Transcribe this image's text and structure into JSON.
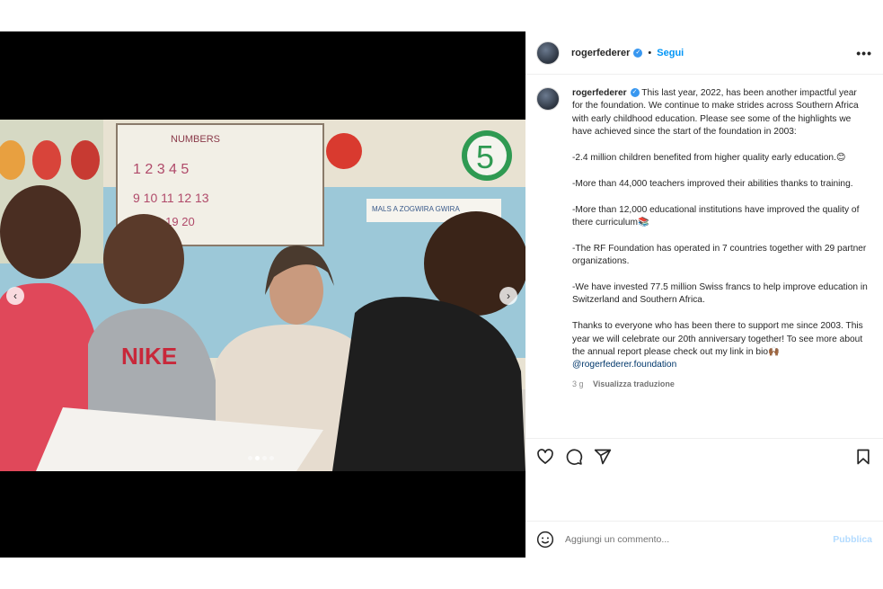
{
  "post": {
    "username": "rogerfederer",
    "follow_label": "Segui",
    "more_label": "•••",
    "separator": "•"
  },
  "media": {
    "prev_label": "‹",
    "next_label": "›",
    "carousel_count": 4,
    "carousel_active": 1
  },
  "caption": {
    "username": "rogerfederer",
    "paragraphs": [
      "This last year, 2022, has been another impactful year for the foundation. We continue to make strides across Southern Africa with early childhood education. Please see some of the highlights we have achieved since the start of the foundation in 2003:",
      "-2.4 million children benefited from higher quality early education.😊",
      "-More than 44,000 teachers improved their abilities thanks to training.",
      "-More than 12,000 educational institutions have improved the quality of there curriculum📚",
      "-The RF Foundation has operated in 7 countries together with 29 partner organizations.",
      "-We have invested 77.5 million Swiss francs to help improve education in Switzerland and Southern Africa."
    ],
    "closing_text": "Thanks to everyone who has been there to support me since 2003. This year we will celebrate our 20th anniversary together! To see more about the annual report please check out my link in bio🙌🏾",
    "mention": "@rogerfederer.foundation",
    "time_ago": "3 g",
    "translate_label": "Visualizza traduzione"
  },
  "actions": {
    "like": "heart-icon",
    "comment": "comment-icon",
    "share": "share-icon",
    "save": "bookmark-icon"
  },
  "comment_box": {
    "placeholder": "Aggiungi un commento...",
    "value": "",
    "publish_label": "Pubblica"
  },
  "colors": {
    "accent": "#0095f6",
    "publish_disabled": "#b3dbff",
    "verified": "#3897f0",
    "divider": "#efefef"
  }
}
